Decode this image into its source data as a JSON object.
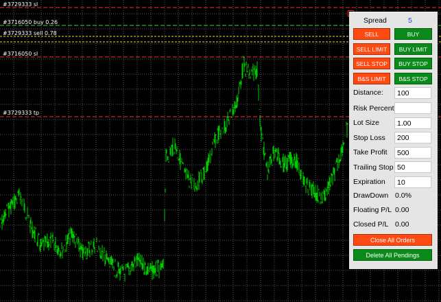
{
  "chart": {
    "background": "#000000",
    "grid_color": "#5a5a5a",
    "price_color": "#00cc00",
    "sl_line_color": "#ff2a2a",
    "sell_line_color": "#ffd24a",
    "buy_line_color": "#3ecf3e",
    "order_lines": [
      {
        "label": "#3729333 sl"
      },
      {
        "label": "#3716050 buy 0.26"
      },
      {
        "label": "#3729333 sell 0.78"
      },
      {
        "label": "#3716050 sl"
      },
      {
        "label": "#3729333 tp"
      }
    ]
  },
  "panel": {
    "spread_label": "Spread",
    "spread_value": "5",
    "spread_color": "#1e3cff",
    "buttons": {
      "sell": "SELL",
      "buy": "BUY",
      "sell_limit": "SELL LIMIT",
      "buy_limit": "BUY LIMIT",
      "sell_stop": "SELL STOP",
      "buy_stop": "BUY STOP",
      "bs_limit": "B&S LIMIT",
      "bs_stop": "B&S STOP",
      "close_all": "Close All Orders",
      "delete_pendings": "Delete All Pendings"
    },
    "fields": {
      "distance": {
        "label": "Distance:",
        "value": "100"
      },
      "risk_percent": {
        "label": "Risk Percent",
        "value": ""
      },
      "lot_size": {
        "label": "Lot Size",
        "value": "1.00"
      },
      "stop_loss": {
        "label": "Stop Loss",
        "value": "200"
      },
      "take_profit": {
        "label": "Take Profit",
        "value": "500"
      },
      "trailing_stop": {
        "label": "Trailing Stop",
        "value": "50"
      },
      "expiration": {
        "label": "Expiration",
        "value": "10"
      }
    },
    "stats": {
      "drawdown": {
        "label": "DrawDown",
        "value": "0.0%"
      },
      "floating_pl": {
        "label": "Floating P/L",
        "value": "0.00"
      },
      "closed_pl": {
        "label": "Closed P/L",
        "value": "0.00"
      }
    },
    "colors": {
      "sell_red": "#ff4a14",
      "buy_green": "#0a8a1a",
      "panel_bg": "#e5e5e5"
    }
  }
}
